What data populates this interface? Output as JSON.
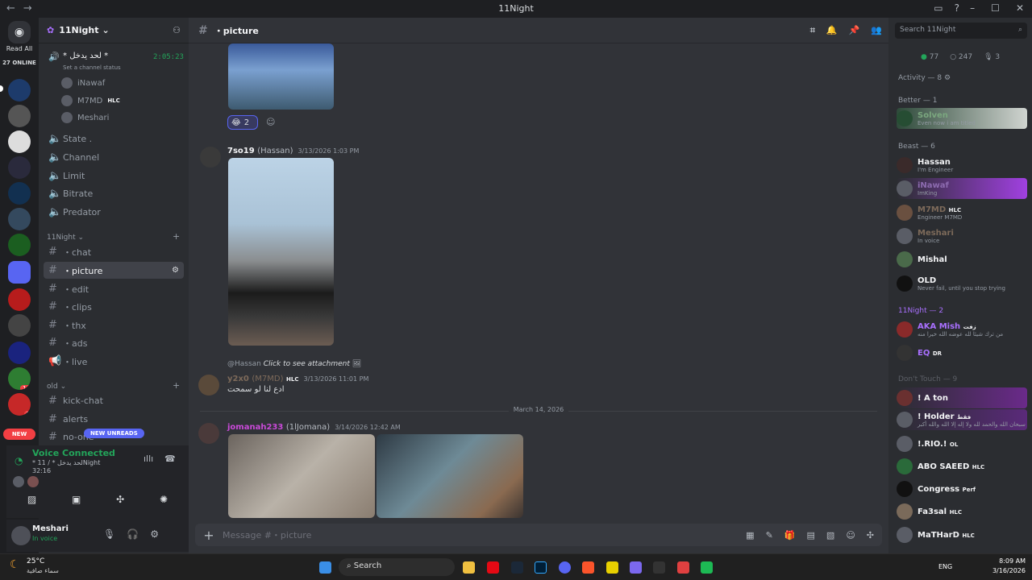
{
  "window": {
    "title": "11Night"
  },
  "server_rail": {
    "read_all": "Read All",
    "online": "27 ONLINE",
    "new_badge": "NEW",
    "badges": [
      "14",
      "1"
    ]
  },
  "channels": {
    "server_name": "11Night",
    "voice_top": {
      "name": "* لحد يدخل *",
      "status": "Set a channel status",
      "timer": "2:05:23",
      "users": [
        "iNawaf",
        "M7MD",
        "Meshari"
      ],
      "tag": "HLC"
    },
    "voice_channels": [
      "State .",
      "Channel",
      "Limit",
      "Bitrate",
      "Predator"
    ],
    "category_1": "11Night",
    "text_channels": [
      "・chat",
      "・picture",
      "・edit",
      "・clips",
      "・thx",
      "・ads",
      "・live"
    ],
    "category_2": "old",
    "old_channels": [
      "kick-chat",
      "alerts",
      "no-one"
    ],
    "new_unreads": "NEW UNREADS"
  },
  "voice_panel": {
    "status": "Voice Connected",
    "channel": "* لحد يدخل * / 11Night",
    "time": "32:16"
  },
  "user_panel": {
    "name": "Meshari",
    "status": "In voice"
  },
  "chat": {
    "channel": "・picture",
    "reaction_count": "2",
    "msg1": {
      "author": "7so19",
      "alias": "(Hassan)",
      "time": "3/13/2026 1:03 PM"
    },
    "reply": {
      "mention": "@Hassan",
      "text": "Click to see attachment"
    },
    "msg2": {
      "author": "y2x0",
      "alias": "(M7MD)",
      "tag": "HLC",
      "time": "3/13/2026 11:01 PM",
      "text": "ادع لنا لو سمحت"
    },
    "divider": "March 14, 2026",
    "msg3": {
      "author": "jomanah233",
      "alias": "(1lJomana)",
      "time": "3/14/2026 12:42 AM"
    },
    "composer_placeholder": "Message #・picture"
  },
  "members": {
    "search_placeholder": "Search 11Night",
    "online": "77",
    "idle": "247",
    "voice": "3",
    "activity": "Activity — 8",
    "groups": [
      {
        "label": "Better — 1",
        "members": [
          {
            "name": "Solven",
            "status": "Even now i am titled"
          }
        ]
      },
      {
        "label": "Beast — 6",
        "members": [
          {
            "name": "Hassan",
            "status": "I'm Engineer"
          },
          {
            "name": "iNawaf",
            "status": "ImKing"
          },
          {
            "name": "M7MD",
            "tag": "HLC",
            "status": "Engineer M7MD"
          },
          {
            "name": "Meshari",
            "status": "In voice"
          },
          {
            "name": "Mishal",
            "status": ""
          },
          {
            "name": "OLD",
            "status": "Never fail, until you stop trying"
          }
        ]
      },
      {
        "label": "11Night — 2",
        "members": [
          {
            "name": "AKA Mish",
            "tag": "زفت",
            "status": "من ترك شيئا لله عوضه الله خيرا منه"
          },
          {
            "name": "EQ",
            "tag": "DR",
            "status": ""
          }
        ]
      },
      {
        "label": "Don't Touch — 9",
        "members": [
          {
            "name": "! A ton",
            "status": ""
          },
          {
            "name": "! Holder",
            "tag": "فقط",
            "status": "سبحان الله والحمد لله ولا إله إلا الله والله أكبر"
          },
          {
            "name": "!.RIO.!",
            "tag": "OL",
            "status": ""
          },
          {
            "name": "ABO SAEED",
            "tag": "HLC",
            "status": ""
          },
          {
            "name": "Congress",
            "tag": "Perf",
            "status": ""
          },
          {
            "name": "Fa3sal",
            "tag": "HLC",
            "status": ""
          },
          {
            "name": "MaTHarD",
            "tag": "HLC",
            "status": ""
          }
        ]
      }
    ]
  },
  "taskbar": {
    "temp": "25°C",
    "weather": "سماء صافية",
    "search": "Search",
    "lang": "ENG",
    "time": "8:09 AM",
    "date": "3/16/2026"
  },
  "colors": {
    "accent": "#5865f2",
    "online": "#23a55a",
    "danger": "#f23f43",
    "purple": "#a970ff"
  }
}
